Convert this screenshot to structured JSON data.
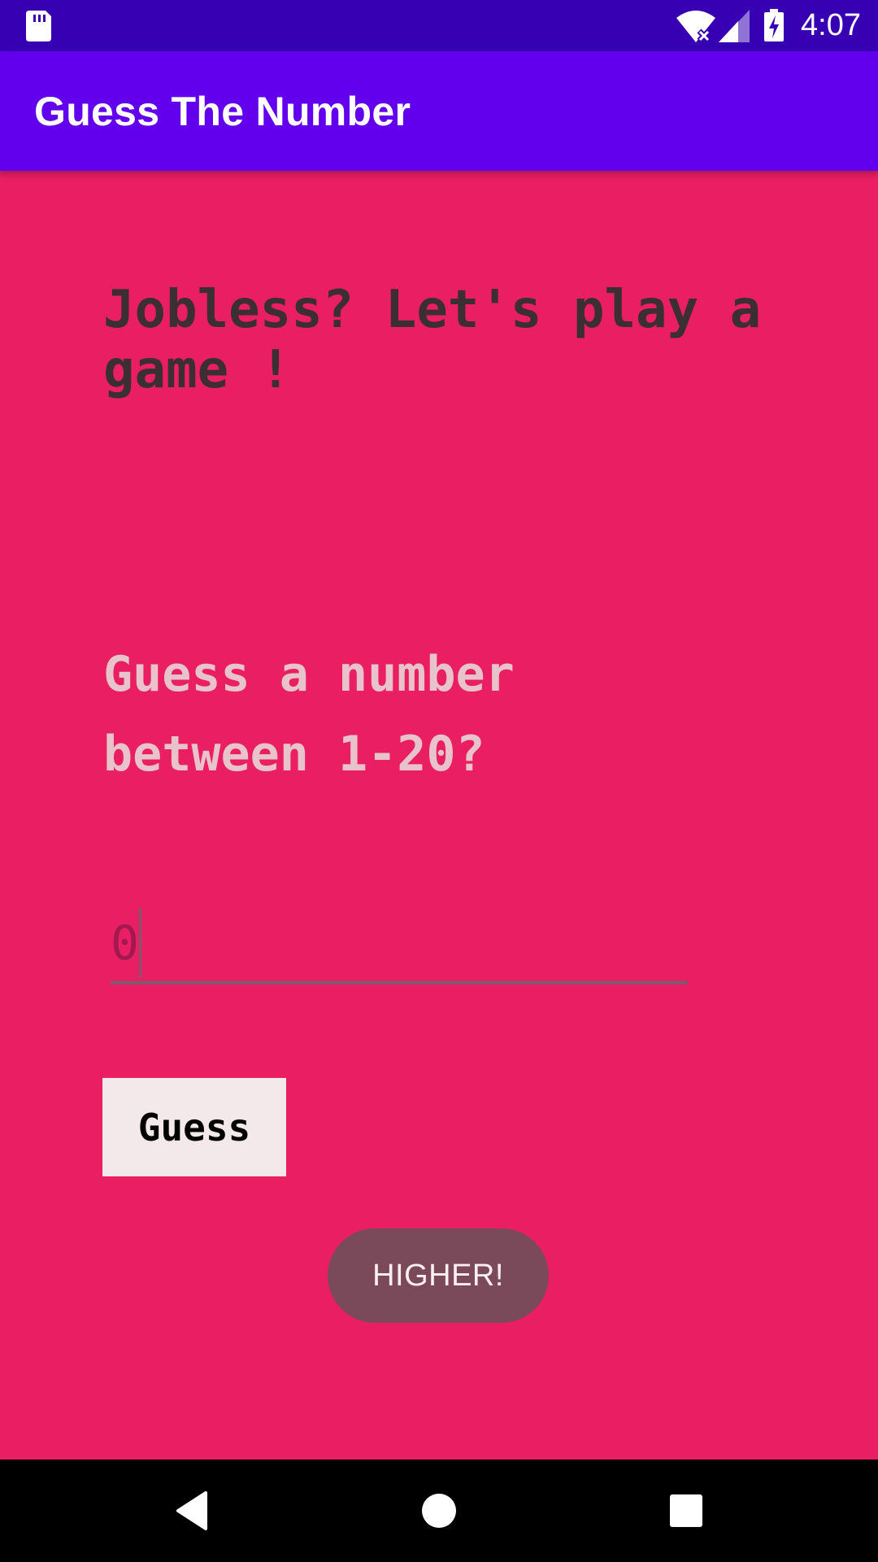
{
  "status_bar": {
    "time": "4:07",
    "icons": [
      "sd-card-icon",
      "wifi-icon",
      "cell-signal-icon",
      "battery-charging-icon"
    ]
  },
  "app_bar": {
    "title": "Guess The Number"
  },
  "main": {
    "headline": "Jobless? Let's play a game !",
    "prompt": "Guess a number between 1-20?",
    "input_value": "0",
    "guess_button_label": "Guess",
    "toast": "HIGHER!"
  },
  "nav_bar": {
    "icons": [
      "back-icon",
      "home-icon",
      "recents-icon"
    ]
  },
  "colors": {
    "status_bar": "#3700B3",
    "app_bar": "#6200EE",
    "background": "#E91E63",
    "headline_text": "#3B2F33",
    "prompt_text": "#E8C3CC",
    "button_bg": "#F4E9EA",
    "toast_bg": "#7A4A5A"
  }
}
